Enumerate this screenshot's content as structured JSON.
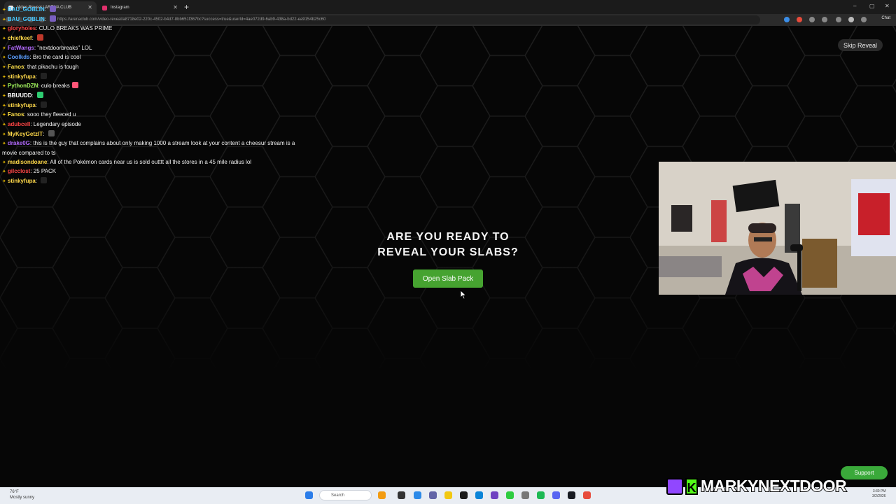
{
  "browser": {
    "tabs": [
      {
        "label": "Video Reveal | ARENA CLUB",
        "active": true
      },
      {
        "label": "Instagram",
        "active": false
      }
    ],
    "new_tab_symbol": "+",
    "url": "https://arenaclub.com/video-reveal/a8718e02-220c-4502-b4d7-8bb651f367bc?success=true&userId=4ae072d9-6ab9-438a-bd22-ea9154b25c60",
    "chat_label": "Chat",
    "window_controls": {
      "minimize": "–",
      "maximize": "▢",
      "close": "✕"
    }
  },
  "chat": [
    {
      "user": "BAU_GOBLIN",
      "color": "#46c7ff",
      "text": "",
      "emote": "#7a5fbf"
    },
    {
      "user": "BAU_GOBLIN",
      "color": "#46c7ff",
      "text": "",
      "emote": "#7a5fbf"
    },
    {
      "user": "gloryholes",
      "color": "#ff4646",
      "text": "CULO BREAKS WAS PRIME",
      "emote": ""
    },
    {
      "user": "chiefkeef",
      "color": "#ffd94a",
      "text": "",
      "emote": "#c0392b"
    },
    {
      "user": "FatWangs",
      "color": "#b36bff",
      "text": "\"nextdoorbreaks\" LOL",
      "emote": ""
    },
    {
      "user": "Coolkds",
      "color": "#5b9dff",
      "text": "Bro the card is cool",
      "emote": ""
    },
    {
      "user": "Fanos",
      "color": "#ffe14a",
      "text": "that pikachu is tough",
      "emote": ""
    },
    {
      "user": "stinkyfupa",
      "color": "#ffd94a",
      "text": "",
      "emote": "#222"
    },
    {
      "user": "PythonDZN",
      "color": "#9ff05a",
      "text": "culo breaks",
      "emote": "#ff5577"
    },
    {
      "user": "BBUUDD",
      "color": "#ffffff",
      "text": "",
      "emote": "#2ecc71"
    },
    {
      "user": "stinkyfupa",
      "color": "#ffd94a",
      "text": "",
      "emote": "#222"
    },
    {
      "user": "Fanos",
      "color": "#ffe14a",
      "text": "sooo they fleeced u",
      "emote": ""
    },
    {
      "user": "adubcell",
      "color": "#ff4646",
      "text": "Legendary episode",
      "emote": ""
    },
    {
      "user": "MyKeyGetzIT",
      "color": "#ffd94a",
      "text": "",
      "emote": "#555"
    },
    {
      "user": "drake0G",
      "color": "#b36bff",
      "text": "this is the guy that complains about only making 1000 a stream look at your content a cheesur stream is a",
      "emote": ""
    },
    {
      "user": "",
      "color": "#ffffff",
      "text": "movie compared to ts",
      "emote": ""
    },
    {
      "user": "madisondoane",
      "color": "#ffd94a",
      "text": "All of the Pokémon cards near us is sold outttt all the stores in a 45 mile radius lol",
      "emote": ""
    },
    {
      "user": "gilcclost",
      "color": "#ff4646",
      "text": "25 PACK",
      "emote": ""
    },
    {
      "user": "stinkyfupa",
      "color": "#ffd94a",
      "text": "",
      "emote": "#222"
    }
  ],
  "page": {
    "skip_label": "Skip Reveal",
    "headline_line1": "ARE YOU READY TO",
    "headline_line2": "REVEAL YOUR SLABS?",
    "open_button": "Open Slab Pack",
    "support_label": "Support"
  },
  "taskbar": {
    "weather_temp": "76°F",
    "weather_desc": "Mostly sunny",
    "search_placeholder": "Search",
    "time": "3:30 PM",
    "date": "3/2/2026"
  },
  "overlay": {
    "kick_letter": "K",
    "streamer_name": "MARKYNEXTDOOR"
  },
  "colors": {
    "accent_green": "#46a330",
    "support_green": "#3aa93a",
    "twitch_purple": "#9147ff",
    "kick_green": "#53fc18"
  }
}
